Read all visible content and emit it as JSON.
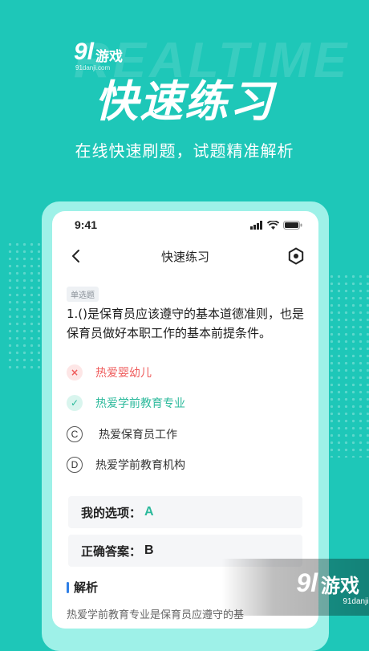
{
  "background": {
    "word": "REALTIME",
    "color": "#1ec7b8"
  },
  "watermark_top": {
    "number": "9l",
    "text": "游戏",
    "sub": "91danji.com"
  },
  "hero": {
    "title": "快速练习",
    "subtitle": "在线快速刷题，试题精准解析"
  },
  "phone": {
    "status": {
      "time": "9:41",
      "icons": [
        "signal-icon",
        "wifi-icon",
        "battery-icon"
      ]
    },
    "navbar": {
      "title": "快速练习",
      "back_icon": "chevron-left-icon",
      "setting_icon": "hexagon-gear-icon"
    },
    "question": {
      "type": "单选题",
      "text": "1.()是保育员应该遵守的基本道德准则，也是保育员做好本职工作的基本前提条件。",
      "options": [
        {
          "mark": "×",
          "label": "热爱婴幼儿",
          "state": "wrong"
        },
        {
          "mark": "✓",
          "label": "热爱学前教育专业",
          "state": "correct"
        },
        {
          "mark": "C",
          "label": "热爱保育员工作",
          "state": "plain"
        },
        {
          "mark": "D",
          "label": "热爱学前教育机构",
          "state": "plain"
        }
      ]
    },
    "my_choice": {
      "label": "我的选项：",
      "value": "A"
    },
    "correct_answer": {
      "label": "正确答案：",
      "value": "B"
    },
    "analysis": {
      "title": "解析",
      "text": "热爱学前教育专业是保育员应遵守的基"
    }
  },
  "watermark_bottom": {
    "number": "9l",
    "text": "游戏",
    "sub": "91danji.com"
  },
  "colors": {
    "accent": "#1ec7b8",
    "correct": "#2bb99b",
    "wrong": "#ef5b5b",
    "section_bar": "#2f7fe6"
  }
}
